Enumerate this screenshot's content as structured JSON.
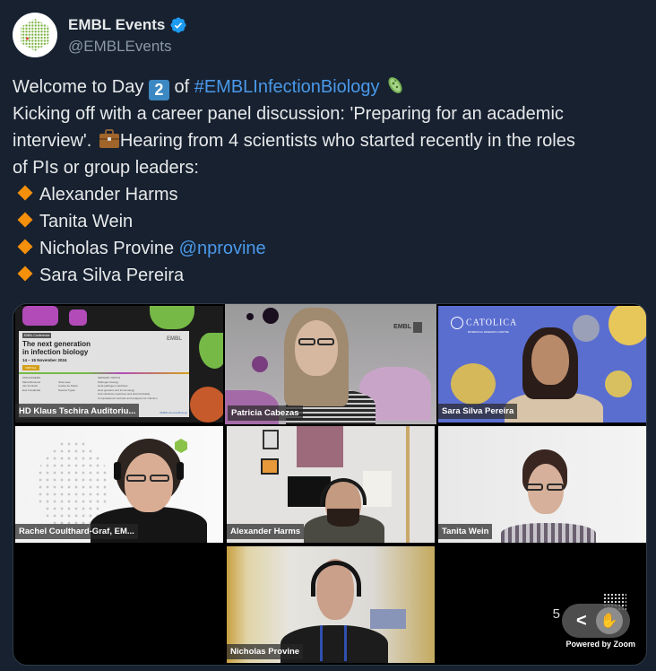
{
  "account": {
    "display_name": "EMBL Events",
    "handle": "@EMBLEvents",
    "verified": true,
    "avatar_icon": "embl-hexagon-logo"
  },
  "tweet": {
    "line1_pre": "Welcome to Day ",
    "day_keycap": "2",
    "line1_mid": " of ",
    "hashtag": "#EMBLInfectionBiology",
    "line1_emoji": "microbe-emoji",
    "line2": "Kicking off with a career panel discussion: 'Preparing for an academic",
    "line3_pre": "interview'. ",
    "line3_emoji": "briefcase-emoji",
    "line3_post": "Hearing from 4 scientists who started recently in the roles",
    "line4": "of PIs or group leaders:",
    "speakers": [
      {
        "name": "Alexander Harms",
        "mention": ""
      },
      {
        "name": "Tanita Wein",
        "mention": ""
      },
      {
        "name": "Nicholas Provine",
        "mention": "@nprovine"
      },
      {
        "name": "Sara Silva Pereira",
        "mention": ""
      }
    ],
    "link_color": "#4a99e9",
    "bullet_color": "#f4900c"
  },
  "zoom_call": {
    "tiles": [
      {
        "name": "HD Klaus Tschira Auditoriu...",
        "active": false,
        "kind": "slide"
      },
      {
        "name": "Patricia Cabezas",
        "active": true,
        "kind": "person"
      },
      {
        "name": "Sara Silva Pereira",
        "active": false,
        "kind": "person"
      },
      {
        "name": "Rachel Coulthard-Graf, EM...",
        "active": false,
        "kind": "person"
      },
      {
        "name": "Alexander Harms",
        "active": false,
        "kind": "person"
      },
      {
        "name": "Tanita Wein",
        "active": false,
        "kind": "person"
      },
      {
        "name": "Nicholas Provine",
        "active": false,
        "kind": "person"
      }
    ],
    "slide": {
      "tag": "EMBL Conference",
      "title_line1": "The next generation",
      "title_line2": "in infection biology",
      "dates": "14 – 15 November 2024",
      "badge": "VIRTUAL",
      "organisers_label": "ORGANISERS",
      "organisers": [
        "Maria Borisova",
        "Jan Kozinski",
        "Eva Kowalinski",
        "Julia Laas",
        "Lisette de Paula",
        "Nassos Typas"
      ],
      "topics_label": "SESSION TOPICS",
      "topics": [
        "Pathogen biology",
        "Host-pathogen interfaces",
        "Host genetics and immunology",
        "Anti-infectives (vaccines and antimicrobials)",
        "Computational methods and analyses for infection"
      ],
      "hashtag": "#EMBLinfectionBiology",
      "logo_text": "EMBL"
    },
    "backgrounds": {
      "embl_logo": "EMBL",
      "catolica_logo": "CATOLICA",
      "catolica_sub": "BIOMEDICAL RESEARCH CENTRE"
    },
    "active_speaker_color": "#7ed321",
    "controls": {
      "back_label": "<",
      "reaction_icon": "raise-hand-icon",
      "powered_by": "Powered by Zoom",
      "partial_logo_text": "5"
    }
  }
}
